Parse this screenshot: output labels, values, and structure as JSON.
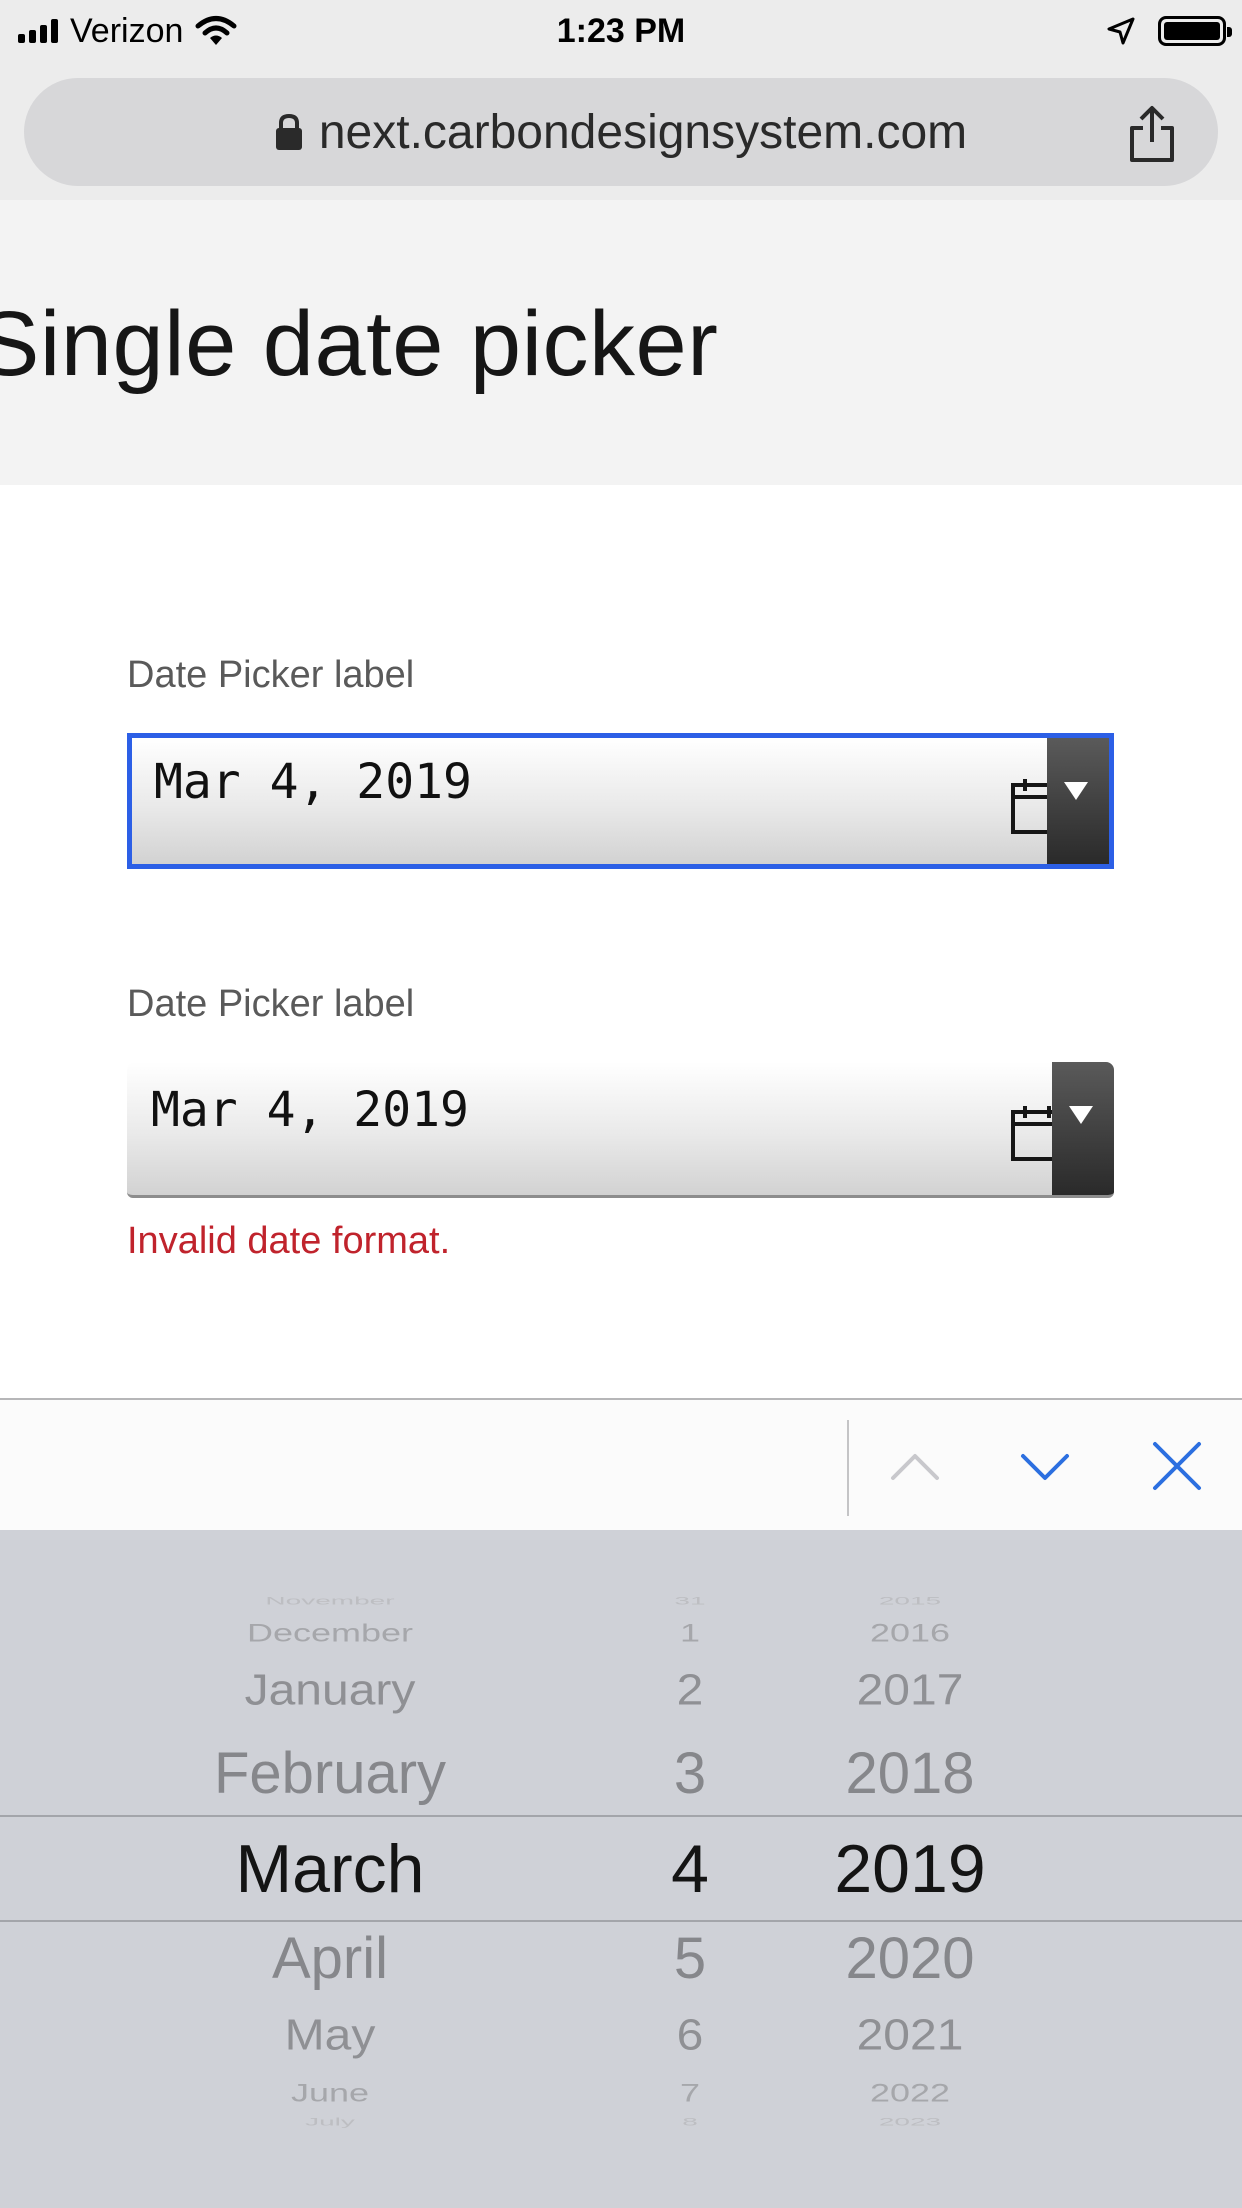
{
  "status_bar": {
    "carrier": "Verizon",
    "time": "1:23 PM"
  },
  "browser": {
    "url": "next.carbondesignsystem.com"
  },
  "page": {
    "title": "Single date picker"
  },
  "date_pickers": [
    {
      "label": "Date Picker label",
      "value": "Mar 4, 2019",
      "state": "focused"
    },
    {
      "label": "Date Picker label",
      "value": "Mar 4, 2019",
      "state": "invalid",
      "error": "Invalid date format."
    }
  ],
  "picker_wheel": {
    "months": [
      "November",
      "December",
      "January",
      "February",
      "March",
      "April",
      "May",
      "June",
      "July"
    ],
    "days": [
      "31",
      "1",
      "2",
      "3",
      "4",
      "5",
      "6",
      "7",
      "8"
    ],
    "years": [
      "2015",
      "2016",
      "2017",
      "2018",
      "2019",
      "2020",
      "2021",
      "2022",
      "2023"
    ],
    "selected": {
      "month": "March",
      "day": "4",
      "year": "2019"
    }
  },
  "colors": {
    "focus_border": "#2c5fe6",
    "error_text": "#c0232c",
    "accessory_icon": "#2c6fe0"
  },
  "icons": [
    "signal-icon",
    "wifi-icon",
    "location-arrow-icon",
    "battery-icon",
    "lock-icon",
    "share-icon",
    "calendar-icon",
    "chevron-up-icon",
    "chevron-down-icon",
    "close-icon"
  ]
}
